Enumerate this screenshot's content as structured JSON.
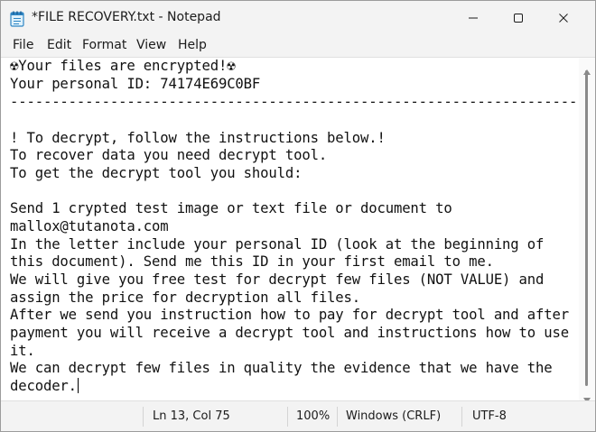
{
  "window": {
    "title": "*FILE RECOVERY.txt - Notepad",
    "app_icon": "notepad-icon",
    "controls": [
      "minimize-icon",
      "maximize-icon",
      "close-icon"
    ]
  },
  "menu": {
    "items": [
      {
        "label": "File"
      },
      {
        "label": "Edit"
      },
      {
        "label": "Format"
      },
      {
        "label": "View"
      },
      {
        "label": "Help"
      }
    ]
  },
  "document": {
    "lines": [
      "☢Your files are encrypted!☢",
      "Your personal ID: 74174E69C0BF",
      "-----------------------------------------------------------------------------",
      "",
      "! To decrypt, follow the instructions below.!",
      "To recover data you need decrypt tool.",
      "To get the decrypt tool you should:",
      "",
      "Send 1 crypted test image or text file or document to",
      "mallox@tutanota.com",
      "In the letter include your personal ID (look at the beginning of",
      "this document). Send me this ID in your first email to me.",
      "We will give you free test for decrypt few files (NOT VALUE) and",
      "assign the price for decryption all files.",
      "After we send you instruction how to pay for decrypt tool and after",
      "payment you will receive a decrypt tool and instructions how to use",
      "it.",
      "We can decrypt few files in quality the evidence that we have the",
      "decoder."
    ]
  },
  "status": {
    "position": "Ln 13, Col 75",
    "zoom": "100%",
    "line_endings": "Windows (CRLF)",
    "encoding": "UTF-8"
  }
}
